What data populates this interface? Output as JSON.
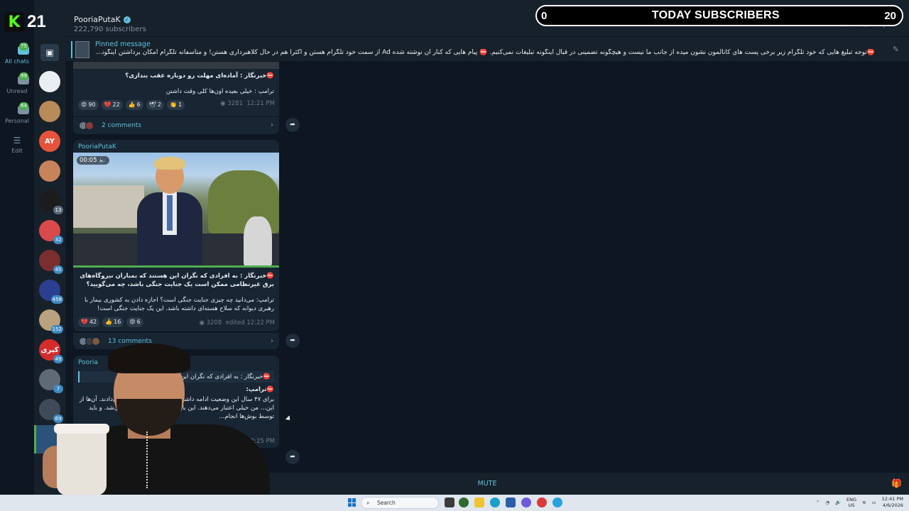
{
  "overlay": {
    "kick_count": "21",
    "subs_left": "0",
    "subs_title": "TODAY SUBSCRIBERS",
    "subs_right": "20"
  },
  "rail": {
    "folders": [
      {
        "label": "All chats",
        "badge": "75"
      },
      {
        "label": "Unread",
        "badge": "99"
      },
      {
        "label": "Personal",
        "badge": "64"
      },
      {
        "label": "Edit",
        "badge": ""
      }
    ]
  },
  "chatlist": {
    "avatars": [
      {
        "text": "",
        "badge": "",
        "color": "#e9eef2"
      },
      {
        "text": "",
        "badge": "",
        "color": "#b98a5a"
      },
      {
        "text": "AY",
        "badge": "",
        "color": "#e5533d"
      },
      {
        "text": "",
        "badge": "",
        "color": "#c7845b"
      },
      {
        "text": "",
        "badge": "13",
        "color": "#1c1c1c"
      },
      {
        "text": "",
        "badge": "32",
        "color": "#d94a4a"
      },
      {
        "text": "",
        "badge": "45",
        "color": "#7a2e2e"
      },
      {
        "text": "",
        "badge": "458",
        "color": "#2c3e8f"
      },
      {
        "text": "",
        "badge": "152",
        "color": "#b9a27d"
      },
      {
        "text": "کیری",
        "badge": "49",
        "color": "#d62b2b"
      },
      {
        "text": "",
        "badge": "7",
        "color": "#5e6a76"
      },
      {
        "text": "",
        "badge": "69",
        "color": "#3e4a58"
      }
    ]
  },
  "header": {
    "channel_name": "PooriaPutaK",
    "subscribers": "222,790 subscribers"
  },
  "pinned": {
    "title": "Pinned message",
    "text": "⛔توجه تبلیغ هایی که خود تلگرام زیر برخی پست های کانالمون نشون میده از جانب ما نیست و هیچگونه تضمینی در قبال اینگونه تبلیغات نمی‌کنیم. ⛔ پیام هایی که کنار ان نوشته شده Ad از سمت خود تلگرام هستن و اکثرا هم در حال کلاهبرداری هستن! و متاسفانه تلگرام امکان برداشتن اینگونه تبلیغات رو به ..."
  },
  "messages": [
    {
      "headline": "⛔خبرنگار : آماده‌ای مهلت رو دوباره عقب بندازی؟",
      "body": "ترامپ : خیلی بعیده اون‌ها کلی وقت داشتن",
      "reactions": [
        {
          "emoji": "😡",
          "count": "90"
        },
        {
          "emoji": "💔",
          "count": "22"
        },
        {
          "emoji": "👍",
          "count": "6"
        },
        {
          "emoji": "🕊",
          "count": "2"
        },
        {
          "emoji": "👏",
          "count": "1"
        }
      ],
      "views": "3281",
      "time": "12:21 PM",
      "comments": "2 comments"
    },
    {
      "sender": "PooriaPutaK",
      "video_time": "00:05",
      "headline": "⛔خبرنگار : به افرادی که نگران این هستند که بمباران نیروگاه‌های برق غیرنظامی ممکن است یک جنایت جنگی باشد، چه می‌گویید؟",
      "body": "ترامپ: می‌دانید چه چیزی جنایت جنگی است؟ اجازه دادن به کشوری بیمار با رهبری دیوانه که سلاح هسته‌ای داشته باشد. این یک جنایت جنگی است!",
      "reactions": [
        {
          "emoji": "💔",
          "count": "42"
        },
        {
          "emoji": "👍",
          "count": "16"
        },
        {
          "emoji": "😡",
          "count": "6"
        }
      ],
      "views": "3208",
      "time": "edited 12:22 PM",
      "comments": "13 comments"
    },
    {
      "sender": "Pooria",
      "quote": "⛔خبرنگار : به افرادی که نگران این",
      "headline": "⛔ترامپ:",
      "body": "برای ۴۷ سال این وضعیت ادامه داشته... باید این کار را انجام می‌دادند. آن‌ها از این... من خیلی اعتبار می‌دهند. این باید توسط اوباما انجام... می‌شد. و باید توسط بوش‌ها انجام...",
      "time": "edited 12:25 PM"
    }
  ],
  "footer": {
    "mute_label": "MUTE"
  },
  "taskbar": {
    "search_placeholder": "Search",
    "lang": "ENG",
    "region": "US",
    "time": "12:41 PM",
    "date": "4/6/2026"
  }
}
